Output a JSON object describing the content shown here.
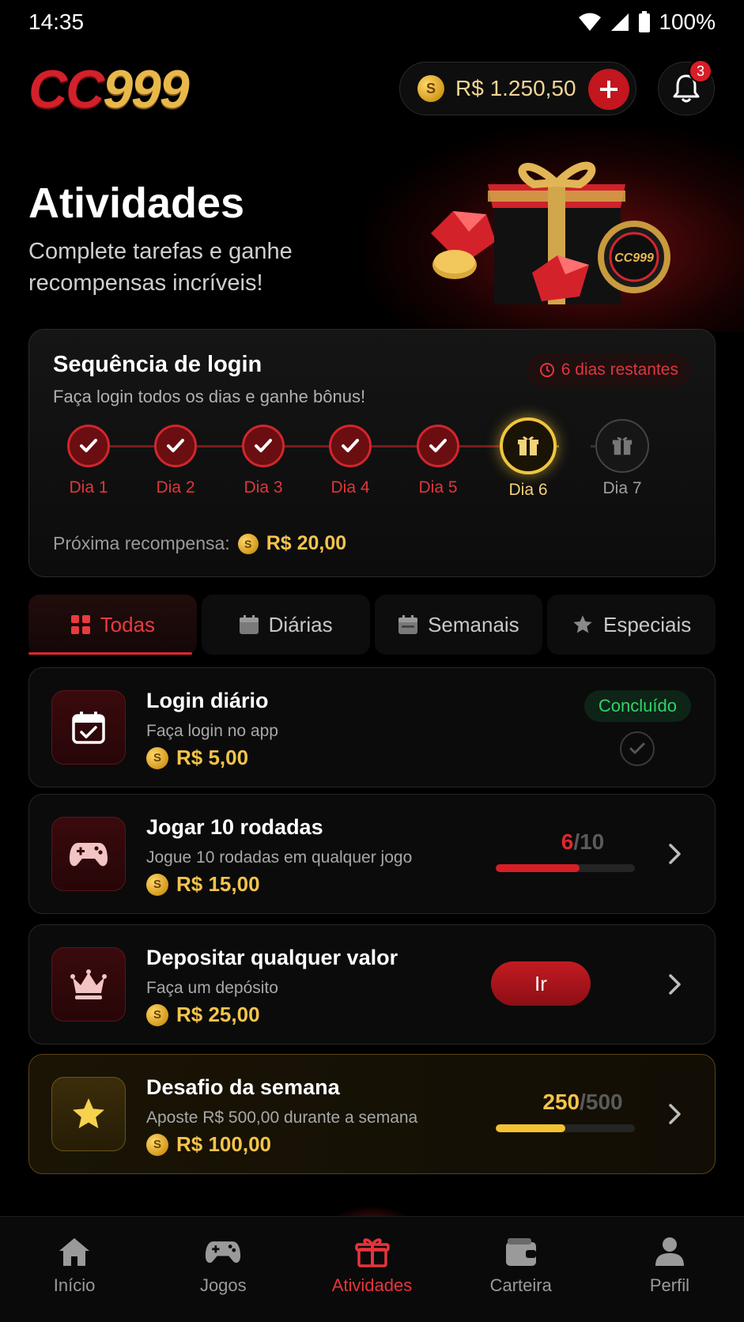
{
  "status": {
    "time": "14:35",
    "battery": "100%"
  },
  "header": {
    "logo_cc": "CC",
    "logo_num": "999",
    "balance": "R$ 1.250,50",
    "coin_symbol": "S",
    "notification_count": "3"
  },
  "hero": {
    "title": "Atividades",
    "subtitle": "Complete tarefas e ganhe recompensas incríveis!",
    "chip_text": "CC999"
  },
  "login_streak": {
    "title": "Sequência de login",
    "subtitle": "Faça login todos os dias e ganhe bônus!",
    "days_left": "6 dias restantes",
    "days": [
      {
        "label": "Dia 1",
        "state": "done"
      },
      {
        "label": "Dia 2",
        "state": "done"
      },
      {
        "label": "Dia 3",
        "state": "done"
      },
      {
        "label": "Dia 4",
        "state": "done"
      },
      {
        "label": "Dia 5",
        "state": "done"
      },
      {
        "label": "Dia 6",
        "state": "current"
      },
      {
        "label": "Dia 7",
        "state": "locked"
      }
    ],
    "next_reward_label": "Próxima recompensa:",
    "next_reward_value": "R$ 20,00"
  },
  "tabs": [
    {
      "label": "Todas",
      "icon": "grid-icon",
      "active": true
    },
    {
      "label": "Diárias",
      "icon": "calendar-icon",
      "active": false
    },
    {
      "label": "Semanais",
      "icon": "calendar-week-icon",
      "active": false
    },
    {
      "label": "Especiais",
      "icon": "star-icon",
      "active": false
    }
  ],
  "tasks": [
    {
      "title": "Login diário",
      "subtitle": "Faça login no app",
      "reward": "R$ 5,00",
      "icon": "calendar-check-icon",
      "status": "Concluído"
    },
    {
      "title": "Jogar 10 rodadas",
      "subtitle": "Jogue 10 rodadas em qualquer jogo",
      "reward": "R$ 15,00",
      "icon": "gamepad-icon",
      "progress_current": "6",
      "progress_sep": "/",
      "progress_total": "10",
      "progress_fraction": 0.6
    },
    {
      "title": "Depositar qualquer valor",
      "subtitle": "Faça um depósito",
      "reward": "R$ 25,00",
      "icon": "crown-icon",
      "button": "Ir"
    },
    {
      "title": "Desafio da semana",
      "subtitle": "Aposte R$ 500,00 durante a semana",
      "reward": "R$ 100,00",
      "icon": "star-icon",
      "progress_current": "250",
      "progress_sep": "/",
      "progress_total": "500",
      "progress_fraction": 0.5
    }
  ],
  "nav": [
    {
      "label": "Início",
      "icon": "home-icon",
      "active": false
    },
    {
      "label": "Jogos",
      "icon": "gamepad-icon",
      "active": false
    },
    {
      "label": "Atividades",
      "icon": "gift-icon",
      "active": true
    },
    {
      "label": "Carteira",
      "icon": "wallet-icon",
      "active": false
    },
    {
      "label": "Perfil",
      "icon": "user-icon",
      "active": false
    }
  ],
  "colors": {
    "accent": "#e0262d",
    "gold": "#f4c44a",
    "success": "#2fd36a",
    "background": "#000000"
  }
}
